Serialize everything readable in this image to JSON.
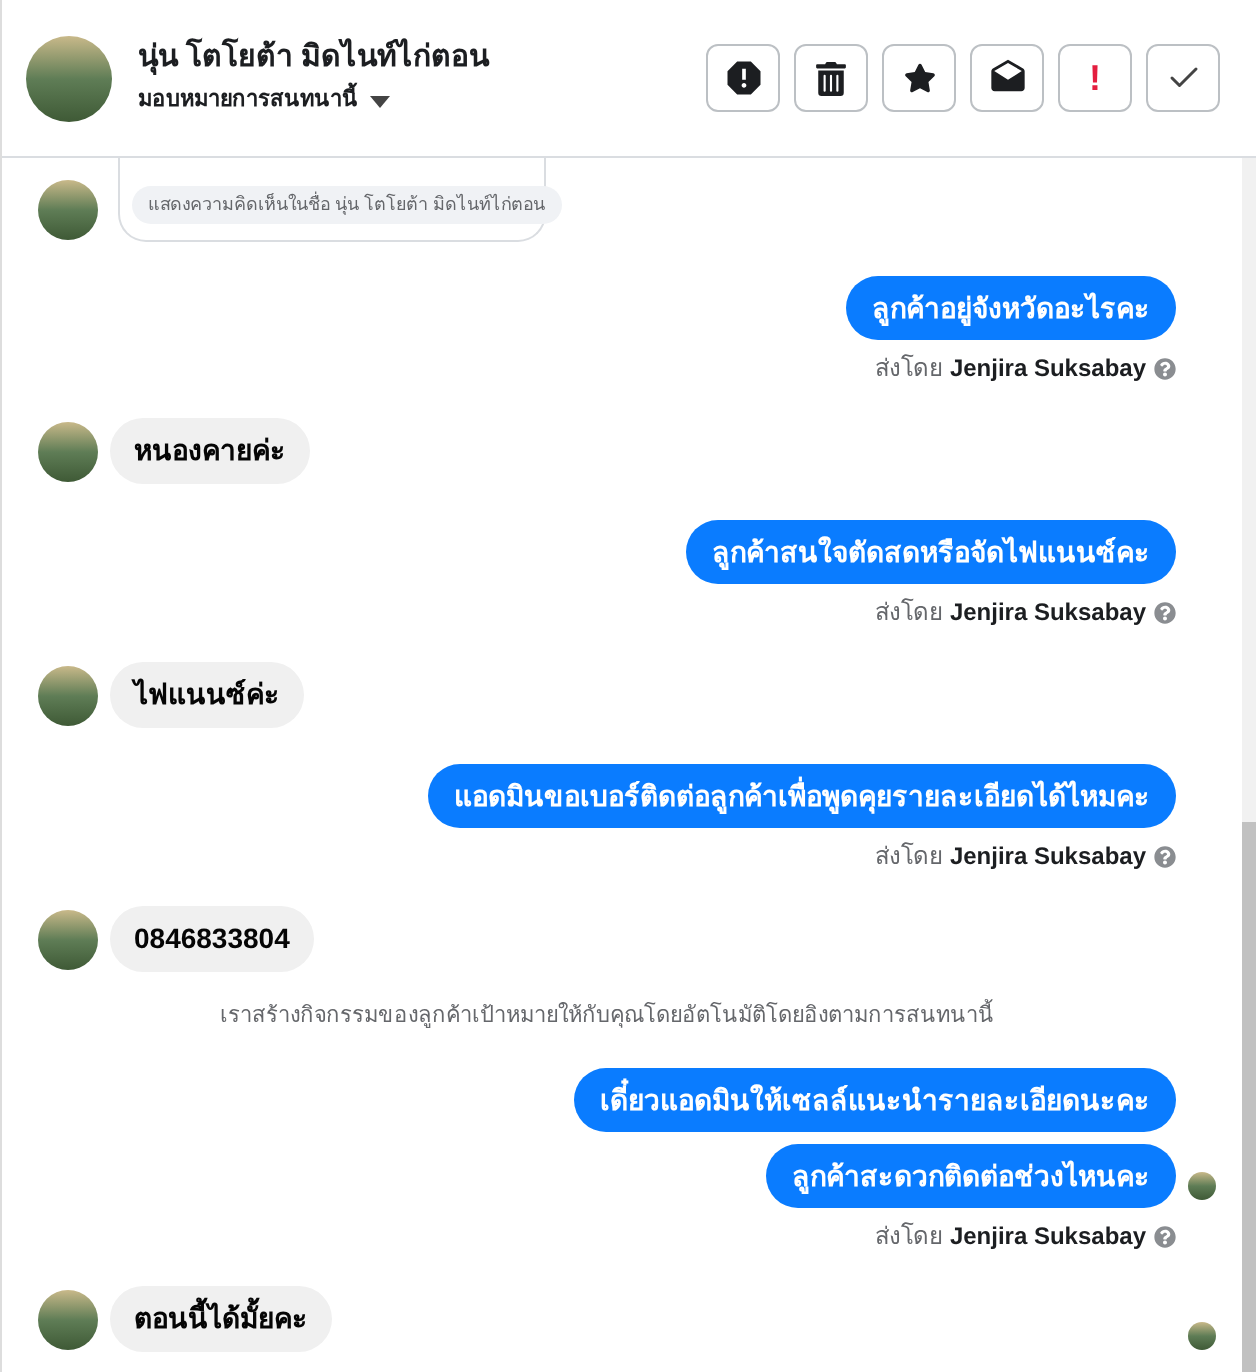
{
  "header": {
    "name": "นุ่น โตโยต้า มิดไนท์ไก่ตอน",
    "assign_label": "มอบหมายการสนทนานี้",
    "actions": [
      {
        "kind": "icon"
      },
      {
        "kind": "icon"
      },
      {
        "kind": "icon"
      },
      {
        "kind": "icon"
      },
      {
        "kind": "text",
        "label": "!"
      },
      {
        "kind": "icon"
      }
    ]
  },
  "messages": [
    {
      "kind": "card",
      "text": "แสดงความคิดเห็นในชื่อ นุ่น โตโยต้า มิดไนท์ไก่ตอน"
    },
    {
      "kind": "outgoing",
      "text": "ลูกค้าอยู่จังหวัดอะไรคะ"
    },
    {
      "kind": "sent_by",
      "prefix": "ส่งโดย",
      "name": "Jenjira Suksabay"
    },
    {
      "kind": "incoming",
      "text": "หนองคายค่ะ"
    },
    {
      "kind": "outgoing",
      "text": "ลูกค้าสนใจตัดสดหรือจัดไฟแนนซ์คะ"
    },
    {
      "kind": "sent_by",
      "prefix": "ส่งโดย",
      "name": "Jenjira Suksabay"
    },
    {
      "kind": "incoming",
      "text": "ไฟแนนซ์ค่ะ"
    },
    {
      "kind": "outgoing",
      "text": "แอดมินขอเบอร์ติดต่อลูกค้าเพื่อพูดคุยรายละเอียดได้ไหมคะ"
    },
    {
      "kind": "sent_by",
      "prefix": "ส่งโดย",
      "name": "Jenjira Suksabay"
    },
    {
      "kind": "incoming",
      "text": "0846833804"
    },
    {
      "kind": "system",
      "text": "เราสร้างกิจกรรมของลูกค้าเป้าหมายให้กับคุณโดยอัตโนมัติโดยอิงตามการสนทนานี้"
    },
    {
      "kind": "outgoing",
      "text": "เดี๋ยวแอดมินให้เซลล์แนะนำรายละเอียดนะคะ"
    },
    {
      "kind": "outgoing",
      "text": "ลูกค้าสะดวกติดต่อช่วงไหนคะ",
      "seen": true
    },
    {
      "kind": "sent_by",
      "prefix": "ส่งโดย",
      "name": "Jenjira Suksabay"
    },
    {
      "kind": "incoming",
      "text": "ตอนนี้ได้มั้ยคะ",
      "seen": true
    }
  ]
}
